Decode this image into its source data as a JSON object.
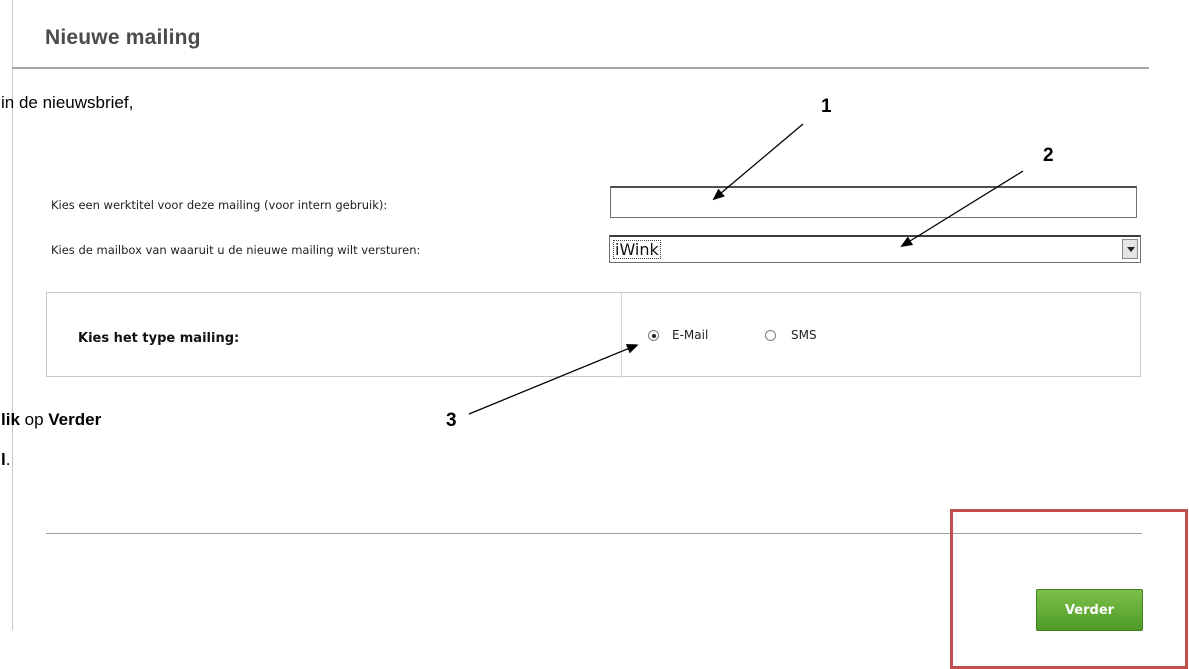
{
  "page": {
    "title": "Nieuwe mailing"
  },
  "doc": {
    "line1": "in de nieuwsbrief,",
    "line2_bold1": "lik",
    "line2_mid": " op ",
    "line2_bold2": "Verder",
    "line3_bold": "l",
    "line3_rest": "."
  },
  "form": {
    "title_label": "Kies een werktitel voor deze mailing (voor intern gebruik):",
    "title_value": "",
    "mailbox_label": "Kies de mailbox van waaruit u de nieuwe mailing wilt versturen:",
    "mailbox_value": "iWink",
    "type_label": "Kies het type mailing:",
    "type_options": [
      {
        "label": "E-Mail",
        "checked": true
      },
      {
        "label": "SMS",
        "checked": false
      }
    ]
  },
  "actions": {
    "next_label": "Verder",
    "next_color": "#5aa631"
  },
  "annotations": {
    "callout_1": "1",
    "callout_2": "2",
    "callout_3": "3",
    "highlight_color": "#c0504d"
  }
}
